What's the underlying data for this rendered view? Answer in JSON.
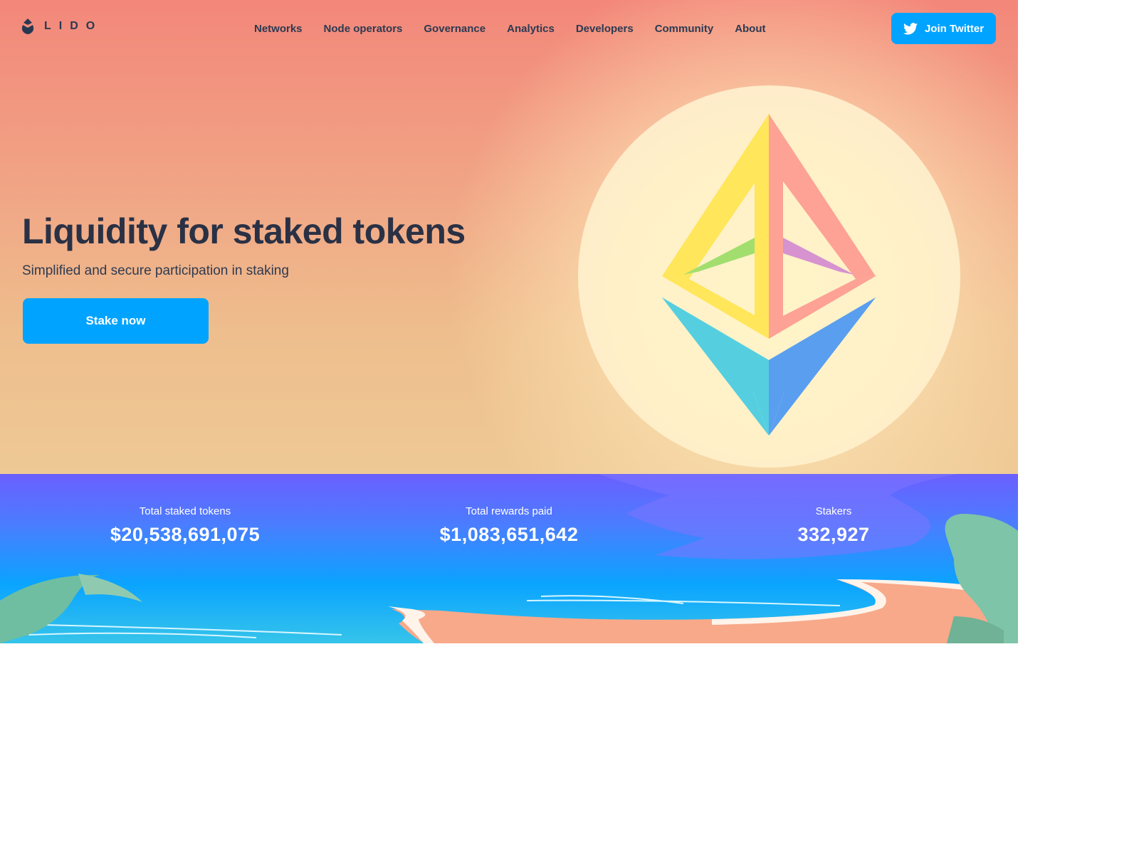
{
  "brand": {
    "logo_text": "LIDO",
    "logo_icon": "lido-drop-icon"
  },
  "nav": {
    "items": [
      {
        "label": "Networks"
      },
      {
        "label": "Node operators"
      },
      {
        "label": "Governance"
      },
      {
        "label": "Analytics"
      },
      {
        "label": "Developers"
      },
      {
        "label": "Community"
      },
      {
        "label": "About"
      }
    ],
    "twitter_button": {
      "label": "Join Twitter",
      "icon": "twitter-bird-icon"
    }
  },
  "hero": {
    "title": "Liquidity for staked tokens",
    "subtitle": "Simplified and secure participation in staking",
    "cta_label": "Stake now",
    "illustration": "ethereum-logo-icon"
  },
  "stats": [
    {
      "label": "Total staked tokens",
      "value": "$20,538,691,075"
    },
    {
      "label": "Total rewards paid",
      "value": "$1,083,651,642"
    },
    {
      "label": "Stakers",
      "value": "332,927"
    }
  ],
  "colors": {
    "accent": "#00a3ff",
    "text_dark": "#2a3145",
    "hero_top": "#f3877a",
    "hero_bottom": "#eec995",
    "stats_top": "#6b5fff",
    "stats_bottom": "#36c4ea",
    "sand": "#f7a98a"
  }
}
